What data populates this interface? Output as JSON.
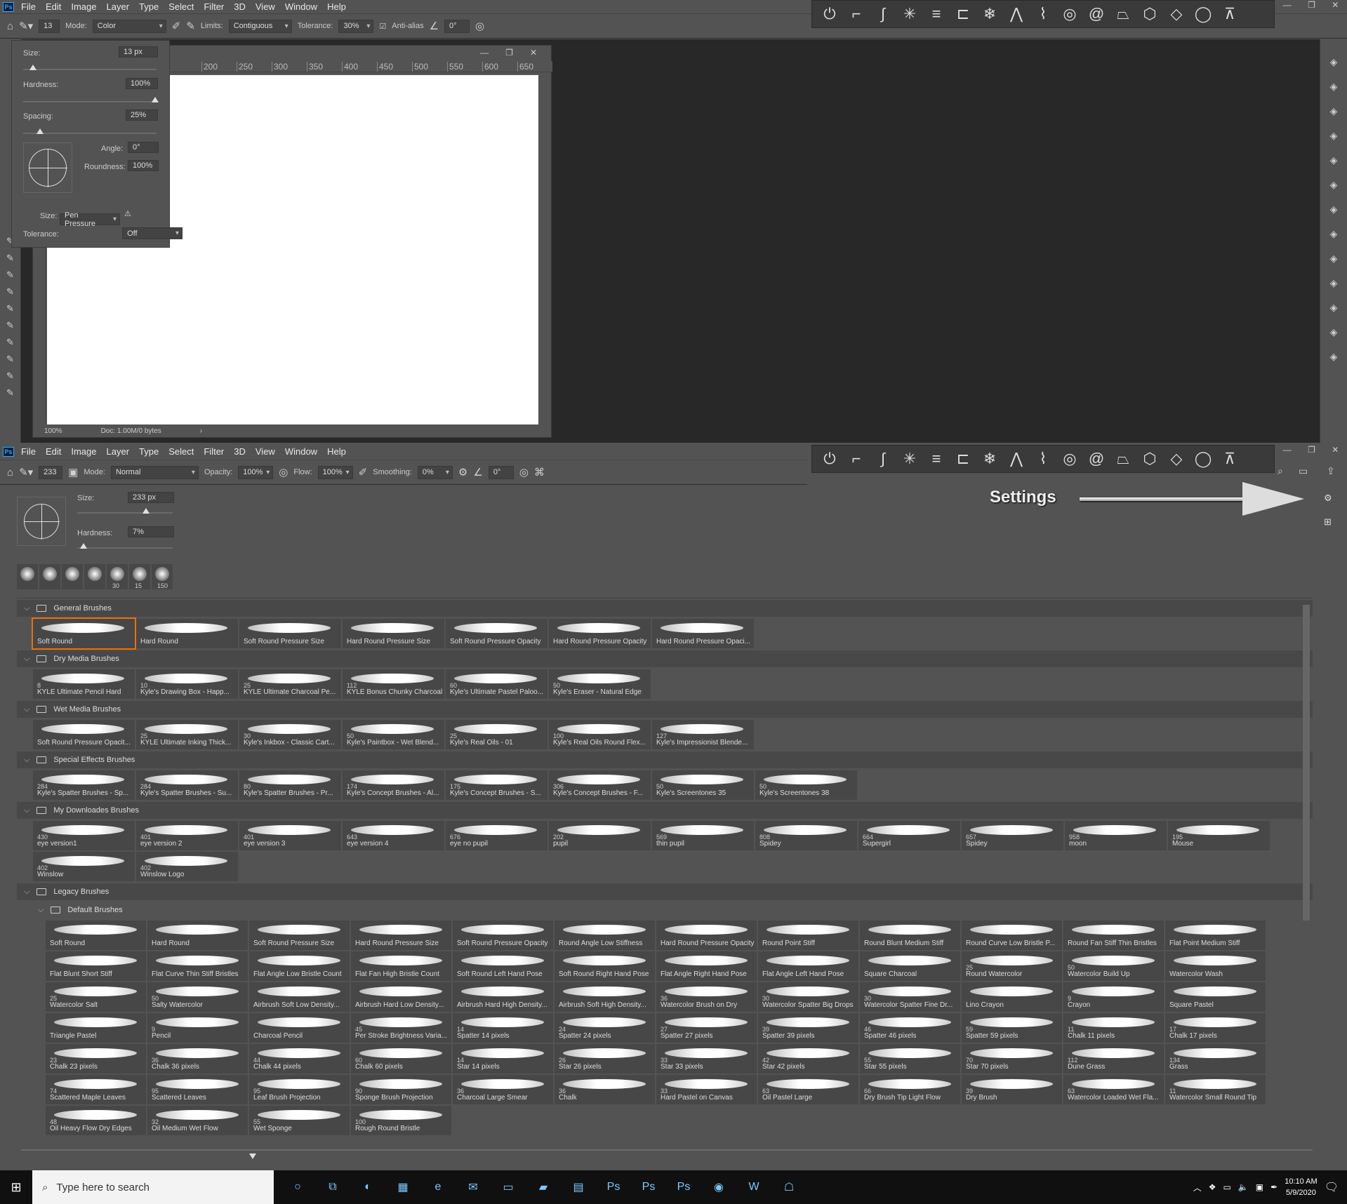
{
  "menu": [
    "File",
    "Edit",
    "Image",
    "Layer",
    "Type",
    "Select",
    "Filter",
    "3D",
    "View",
    "Window",
    "Help"
  ],
  "ps_logo": "Ps",
  "top_options": {
    "brush_size": "13",
    "mode_label": "Mode:",
    "mode_value": "Color",
    "limits_label": "Limits:",
    "limits_value": "Contiguous",
    "tolerance_label": "Tolerance:",
    "tolerance_value": "30%",
    "antialias_label": "Anti-alias",
    "angle_value": "0°"
  },
  "top_popup": {
    "size_label": "Size:",
    "size_value": "13 px",
    "hardness_label": "Hardness:",
    "hardness_value": "100%",
    "spacing_label": "Spacing:",
    "spacing_value": "25%",
    "angle_label": "Angle:",
    "angle_value": "0°",
    "roundness_label": "Roundness:",
    "roundness_value": "100%",
    "size2_label": "Size:",
    "size2_value": "Pen Pressure",
    "tolerance_label": "Tolerance:",
    "tolerance_value": "Off"
  },
  "ruler_ticks": [
    "200",
    "250",
    "300",
    "350",
    "400",
    "450",
    "500",
    "550",
    "600",
    "650"
  ],
  "canvas_status": {
    "zoom": "100%",
    "doc": "Doc: 1.00M/0 bytes"
  },
  "bottom_options": {
    "brush_size": "233",
    "mode_label": "Mode:",
    "mode_value": "Normal",
    "opacity_label": "Opacity:",
    "opacity_value": "100%",
    "flow_label": "Flow:",
    "flow_value": "100%",
    "smoothing_label": "Smoothing:",
    "smoothing_value": "0%",
    "angle_value": "0°"
  },
  "preset_panel": {
    "size_label": "Size:",
    "size_value": "233 px",
    "hardness_label": "Hardness:",
    "hardness_value": "7%",
    "recent": [
      "",
      "",
      "",
      "",
      "30",
      "15",
      "150"
    ]
  },
  "annotation": "Settings",
  "categories": [
    {
      "name": "General Brushes",
      "brushes": [
        [
          "",
          "Soft Round"
        ],
        [
          "",
          "Hard Round"
        ],
        [
          "",
          "Soft Round Pressure Size"
        ],
        [
          "",
          "Hard Round Pressure Size"
        ],
        [
          "",
          "Soft Round Pressure Opacity"
        ],
        [
          "",
          "Hard Round Pressure Opacity"
        ],
        [
          "",
          "Hard Round Pressure Opaci..."
        ]
      ]
    },
    {
      "name": "Dry Media Brushes",
      "brushes": [
        [
          "8",
          "KYLE Ultimate Pencil Hard"
        ],
        [
          "10",
          "Kyle's Drawing Box - Happ..."
        ],
        [
          "25",
          "KYLE Ultimate Charcoal Pe..."
        ],
        [
          "112",
          "KYLE Bonus Chunky Charcoal"
        ],
        [
          "60",
          "Kyle's Ultimate Pastel Paloo..."
        ],
        [
          "50",
          "Kyle's Eraser - Natural Edge"
        ]
      ]
    },
    {
      "name": "Wet Media Brushes",
      "brushes": [
        [
          "",
          "Soft Round Pressure Opacit..."
        ],
        [
          "25",
          "KYLE Ultimate Inking Thick..."
        ],
        [
          "30",
          "Kyle's Inkbox - Classic Cart..."
        ],
        [
          "50",
          "Kyle's Paintbox - Wet Blend..."
        ],
        [
          "25",
          "Kyle's Real Oils - 01"
        ],
        [
          "100",
          "Kyle's Real Oils Round Flex..."
        ],
        [
          "127",
          "Kyle's Impressionist Blende..."
        ]
      ]
    },
    {
      "name": "Special Effects Brushes",
      "brushes": [
        [
          "284",
          "Kyle's Spatter Brushes - Sp..."
        ],
        [
          "284",
          "Kyle's Spatter Brushes - Su..."
        ],
        [
          "80",
          "Kyle's Spatter Brushes - Pr..."
        ],
        [
          "174",
          "Kyle's Concept Brushes - Al..."
        ],
        [
          "175",
          "Kyle's Concept Brushes - S..."
        ],
        [
          "306",
          "Kyle's Concept Brushes - F..."
        ],
        [
          "50",
          "Kyle's Screentones 35"
        ],
        [
          "50",
          "Kyle's Screentones 38"
        ]
      ]
    },
    {
      "name": "My Downloades Brushes",
      "brushes": [
        [
          "430",
          "eye version1"
        ],
        [
          "401",
          "eye version 2"
        ],
        [
          "401",
          "eye version 3"
        ],
        [
          "643",
          "eye version 4"
        ],
        [
          "676",
          "eye no pupil"
        ],
        [
          "202",
          "pupil"
        ],
        [
          "569",
          "thin pupil"
        ],
        [
          "808",
          "Spidey"
        ],
        [
          "664",
          "Supergirl"
        ],
        [
          "657",
          "Spidey"
        ],
        [
          "958",
          "moon"
        ],
        [
          "195",
          "Mouse"
        ],
        [
          "402",
          "Winslow"
        ],
        [
          "402",
          "Winslow Logo"
        ]
      ]
    },
    {
      "name": "Legacy Brushes",
      "brushes": []
    }
  ],
  "subcategory": {
    "name": "Default Brushes",
    "brushes": [
      [
        "",
        "Soft Round"
      ],
      [
        "",
        "Hard Round"
      ],
      [
        "",
        "Soft Round Pressure Size"
      ],
      [
        "",
        "Hard Round Pressure Size"
      ],
      [
        "",
        "Soft Round Pressure Opacity"
      ],
      [
        "",
        "Round Angle Low Stiffness"
      ],
      [
        "",
        "Hard Round Pressure Opacity"
      ],
      [
        "",
        "Round Point Stiff"
      ],
      [
        "",
        "Round Blunt Medium Stiff"
      ],
      [
        "",
        "Round Curve Low Bristle P..."
      ],
      [
        "",
        "Round Fan Stiff Thin Bristles"
      ],
      [
        "",
        "Flat Point Medium Stiff"
      ],
      [
        "",
        "Flat Blunt Short Stiff"
      ],
      [
        "",
        "Flat Curve Thin Stiff Bristles"
      ],
      [
        "",
        "Flat Angle Low Bristle Count"
      ],
      [
        "",
        "Flat Fan High Bristle Count"
      ],
      [
        "",
        "Soft Round Left Hand Pose"
      ],
      [
        "",
        "Soft Round Right Hand Pose"
      ],
      [
        "",
        "Flat Angle Right Hand Pose"
      ],
      [
        "",
        "Flat Angle Left Hand Pose"
      ],
      [
        "",
        "Square Charcoal"
      ],
      [
        "25",
        "Round Watercolor"
      ],
      [
        "50",
        "Watercolor Build Up"
      ],
      [
        "",
        "Watercolor Wash"
      ],
      [
        "25",
        "Watercolor Salt"
      ],
      [
        "50",
        "Salty Watercolor"
      ],
      [
        "",
        "Airbrush Soft Low Density..."
      ],
      [
        "",
        "Airbrush Hard Low Density..."
      ],
      [
        "",
        "Airbrush Hard High Density..."
      ],
      [
        "",
        "Airbrush Soft High Density..."
      ],
      [
        "36",
        "Watercolor Brush on Dry"
      ],
      [
        "30",
        "Watercolor Spatter Big Drops"
      ],
      [
        "30",
        "Watercolor Spatter Fine Dr..."
      ],
      [
        "",
        "Lino Crayon"
      ],
      [
        "9",
        "Crayon"
      ],
      [
        "",
        "Square Pastel"
      ],
      [
        "",
        "Triangle Pastel"
      ],
      [
        "9",
        "Pencil"
      ],
      [
        "",
        "Charcoal Pencil"
      ],
      [
        "45",
        "Per Stroke Brightness Varia..."
      ],
      [
        "14",
        "Spatter 14 pixels"
      ],
      [
        "24",
        "Spatter 24 pixels"
      ],
      [
        "27",
        "Spatter 27 pixels"
      ],
      [
        "39",
        "Spatter 39 pixels"
      ],
      [
        "46",
        "Spatter 46 pixels"
      ],
      [
        "59",
        "Spatter 59 pixels"
      ],
      [
        "11",
        "Chalk 11 pixels"
      ],
      [
        "17",
        "Chalk 17 pixels"
      ],
      [
        "23",
        "Chalk 23 pixels"
      ],
      [
        "36",
        "Chalk 36 pixels"
      ],
      [
        "44",
        "Chalk 44 pixels"
      ],
      [
        "60",
        "Chalk 60 pixels"
      ],
      [
        "14",
        "Star 14 pixels"
      ],
      [
        "26",
        "Star 26 pixels"
      ],
      [
        "33",
        "Star 33 pixels"
      ],
      [
        "42",
        "Star 42 pixels"
      ],
      [
        "55",
        "Star 55 pixels"
      ],
      [
        "70",
        "Star 70 pixels"
      ],
      [
        "112",
        "Dune Grass"
      ],
      [
        "134",
        "Grass"
      ],
      [
        "74",
        "Scattered Maple Leaves"
      ],
      [
        "95",
        "Scattered Leaves"
      ],
      [
        "95",
        "Leaf Brush Projection"
      ],
      [
        "90",
        "Sponge Brush Projection"
      ],
      [
        "36",
        "Charcoal Large Smear"
      ],
      [
        "36",
        "Chalk"
      ],
      [
        "33",
        "Hard Pastel on Canvas"
      ],
      [
        "63",
        "Oil Pastel Large"
      ],
      [
        "66",
        "Dry Brush Tip Light Flow"
      ],
      [
        "39",
        "Dry Brush"
      ],
      [
        "63",
        "Watercolor Loaded Wet Fla..."
      ],
      [
        "11",
        "Watercolor Small Round Tip"
      ],
      [
        "48",
        "Oil Heavy Flow Dry Edges"
      ],
      [
        "32",
        "Oil Medium Wet Flow"
      ],
      [
        "55",
        "Wet Sponge"
      ],
      [
        "100",
        "Rough Round Bristle"
      ]
    ]
  },
  "taskbar": {
    "search_placeholder": "Type here to search",
    "time": "10:10 AM",
    "date": "5/9/2020"
  },
  "colors": {
    "accent": "#e8700a",
    "ps_blue": "#31a8ff",
    "panel": "#535353",
    "dark": "#282828"
  }
}
